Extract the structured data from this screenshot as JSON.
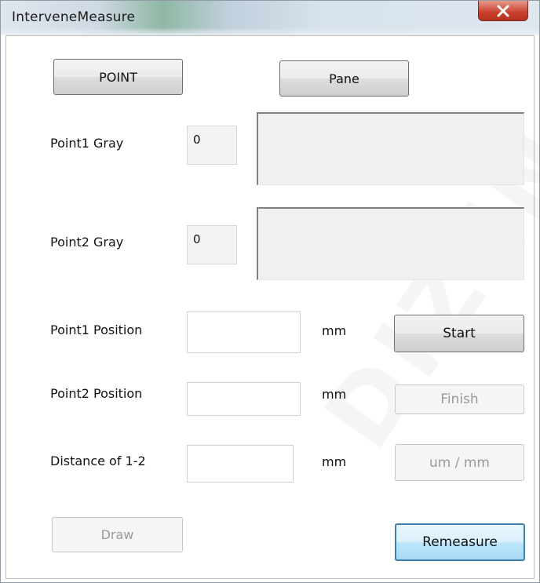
{
  "window": {
    "title": "InterveneMeasure"
  },
  "buttons": {
    "point": "POINT",
    "pane": "Pane",
    "start": "Start",
    "finish": "Finish",
    "unit_toggle": "um / mm",
    "draw": "Draw",
    "remeasure": "Remeasure"
  },
  "gray": {
    "point1_label": "Point1 Gray",
    "point1_value": "0",
    "point2_label": "Point2 Gray",
    "point2_value": "0"
  },
  "positions": {
    "point1_label": "Point1 Position",
    "point1_value": "",
    "point1_unit": "mm",
    "point2_label": "Point2 Position",
    "point2_value": "",
    "point2_unit": "mm",
    "distance_label": "Distance of 1-2",
    "distance_value": "",
    "distance_unit": "mm"
  },
  "icons": {
    "close": "close-x-icon"
  },
  "colors": {
    "close_button": "#c9402c",
    "focus_border": "#3c7fb1"
  }
}
